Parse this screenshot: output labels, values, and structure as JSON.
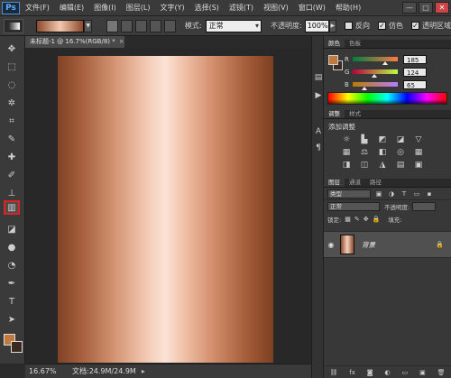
{
  "app": {
    "logo": "Ps"
  },
  "menu": [
    "文件(F)",
    "编辑(E)",
    "图像(I)",
    "图层(L)",
    "文字(Y)",
    "选择(S)",
    "滤镜(T)",
    "视图(V)",
    "窗口(W)",
    "帮助(H)"
  ],
  "window_controls": {
    "minimize": "—",
    "restore": "□",
    "close": "✕"
  },
  "options": {
    "mode_label": "模式:",
    "mode_value": "正常",
    "opacity_label": "不透明度:",
    "opacity_value": "100%",
    "reverse_label": "反向",
    "dither_label": "仿色",
    "transparency_label": "透明区域",
    "reverse_checked": "",
    "dither_checked": "✓",
    "transparency_checked": "✓"
  },
  "document": {
    "tab_title": "未标题-1 @ 16.7%(RGB/8) *",
    "close": "×",
    "gradient_colors": [
      "#804225",
      "#fbe3d6",
      "#7d3f22"
    ]
  },
  "status": {
    "zoom": "16.67%",
    "doc_info": "文档:24.9M/24.9M",
    "arrow": "▸"
  },
  "color_panel": {
    "tabs": [
      "颜色",
      "色板"
    ],
    "foreground": "#c07a3e",
    "background": "#3a2a20",
    "r_label": "R",
    "r_value": "185",
    "g_label": "G",
    "g_value": "124",
    "b_label": "B",
    "b_value": "65",
    "r_level": 0.725,
    "g_level": 0.486,
    "b_level": 0.255
  },
  "adjust_panel": {
    "tabs": [
      "调整",
      "样式"
    ],
    "title": "添加调整"
  },
  "layers_panel": {
    "tabs": [
      "图层",
      "通道",
      "路径"
    ],
    "kind": "类型",
    "mode": "正常",
    "opacity_label": "不透明度:",
    "lock_label": "锁定:",
    "fill_label": "填充:",
    "layer_name": "背景"
  },
  "accent": {
    "active_tool_outline": "#dd2222"
  }
}
